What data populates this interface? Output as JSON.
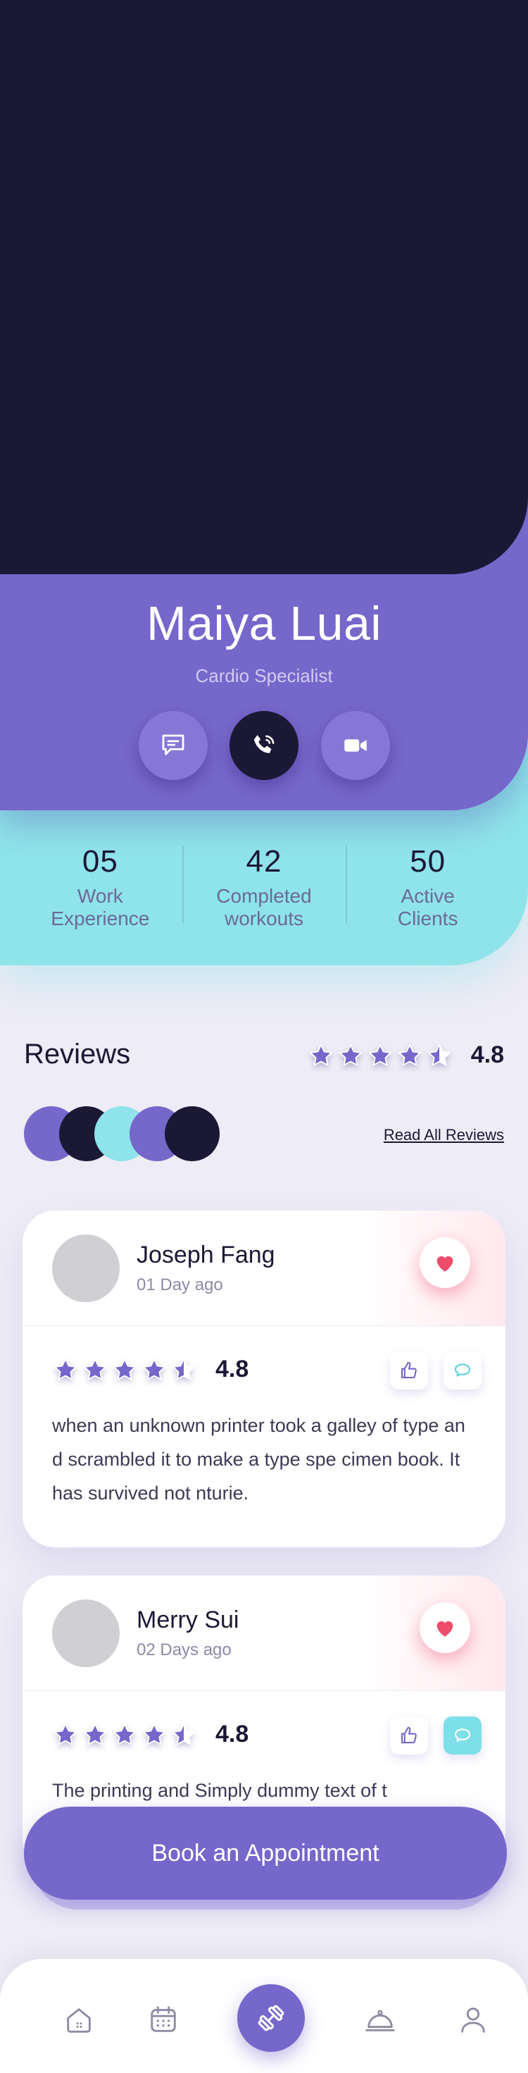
{
  "colors": {
    "primary": "#7667cb",
    "dark": "#1b1835",
    "accent_cyan": "#8fe3ea",
    "heart": "#ef4b6a"
  },
  "profile": {
    "name": "Maiya Luai",
    "role": "Cardio Specialist",
    "contact_icons": [
      "chat-icon",
      "phone-call-icon",
      "video-call-icon"
    ]
  },
  "stats": [
    {
      "value": "05",
      "label_line1": "Work",
      "label_line2": "Experience"
    },
    {
      "value": "42",
      "label_line1": "Completed",
      "label_line2": "workouts"
    },
    {
      "value": "50",
      "label_line1": "Active",
      "label_line2": "Clients"
    }
  ],
  "reviews": {
    "title": "Reviews",
    "overall_rating": "4.8",
    "overall_stars": 4.5,
    "read_all": "Read All Reviews",
    "avatar_colors": [
      "#7667cb",
      "#1b1835",
      "#8fe3ea",
      "#7667cb",
      "#1b1835"
    ],
    "items": [
      {
        "name": "Joseph Fang",
        "date": "01 Day ago",
        "rating": "4.8",
        "stars": 4.5,
        "text": "when an unknown printer took a galley of type and scrambled it to make a type spe cimen book. It has survived not nturie."
      },
      {
        "name": "Merry Sui",
        "date": "02 Days ago",
        "rating": "4.8",
        "stars": 4.5,
        "text": "The printing and Simply dummy text of t"
      }
    ]
  },
  "book_button": "Book an Appointment",
  "nav": [
    "home-icon",
    "calendar-icon",
    "dumbbell-icon",
    "food-cloche-icon",
    "profile-icon"
  ]
}
